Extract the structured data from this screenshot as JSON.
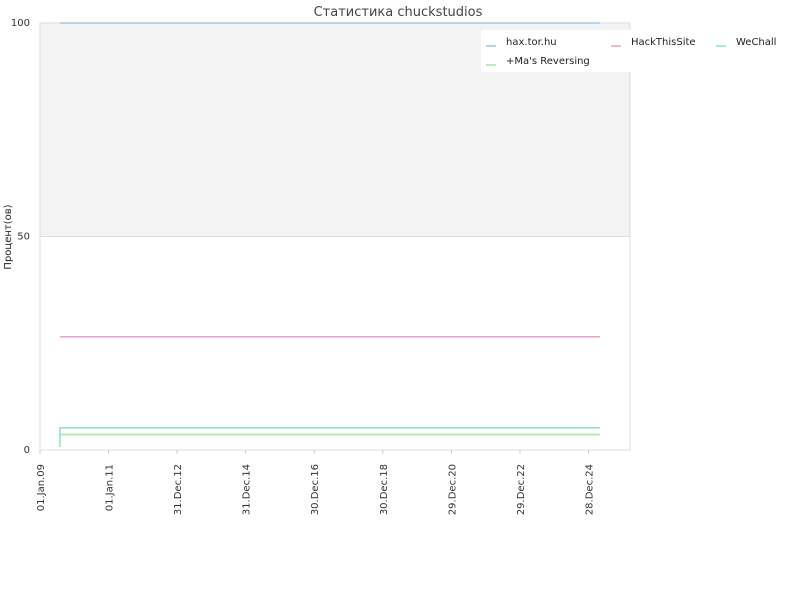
{
  "chart_data": {
    "type": "line",
    "title": "Статистика chuckstudios",
    "ylabel": "Процент(ов)",
    "xlabel": "",
    "ylim": [
      0,
      100
    ],
    "xlim": [
      "2009-01-01",
      "2026-03-15"
    ],
    "y_ticks": [
      0,
      50,
      100
    ],
    "x_ticks": [
      {
        "date": "2009-01-01",
        "label": "01.Jan.09"
      },
      {
        "date": "2011-01-01",
        "label": "01.Jan.11"
      },
      {
        "date": "2012-12-31",
        "label": "31.Dec.12"
      },
      {
        "date": "2014-12-31",
        "label": "31.Dec.14"
      },
      {
        "date": "2016-12-30",
        "label": "30.Dec.16"
      },
      {
        "date": "2018-12-30",
        "label": "30.Dec.18"
      },
      {
        "date": "2020-12-29",
        "label": "29.Dec.20"
      },
      {
        "date": "2022-12-29",
        "label": "29.Dec.22"
      },
      {
        "date": "2024-12-28",
        "label": "28.Dec.24"
      }
    ],
    "grid": true,
    "legend_position": "top-right",
    "series": [
      {
        "name": "hax.tor.hu",
        "color": "#a6c8e8",
        "points": [
          [
            "2009-08-01",
            100
          ],
          [
            "2025-05-01",
            100
          ]
        ]
      },
      {
        "name": "HackThisSite",
        "color": "#e8a6cc",
        "points": [
          [
            "2009-08-01",
            26.5
          ],
          [
            "2025-05-01",
            26.5
          ]
        ]
      },
      {
        "name": "WeChall",
        "color": "#8ee8c8",
        "points": [
          [
            "2009-08-01",
            0.7
          ],
          [
            "2009-08-01",
            5.2
          ],
          [
            "2025-05-01",
            5.2
          ]
        ]
      },
      {
        "name": "+Ma's Reversing",
        "color": "#a6e8a6",
        "points": [
          [
            "2009-08-01",
            3.6
          ],
          [
            "2025-05-01",
            3.6
          ]
        ]
      }
    ]
  }
}
